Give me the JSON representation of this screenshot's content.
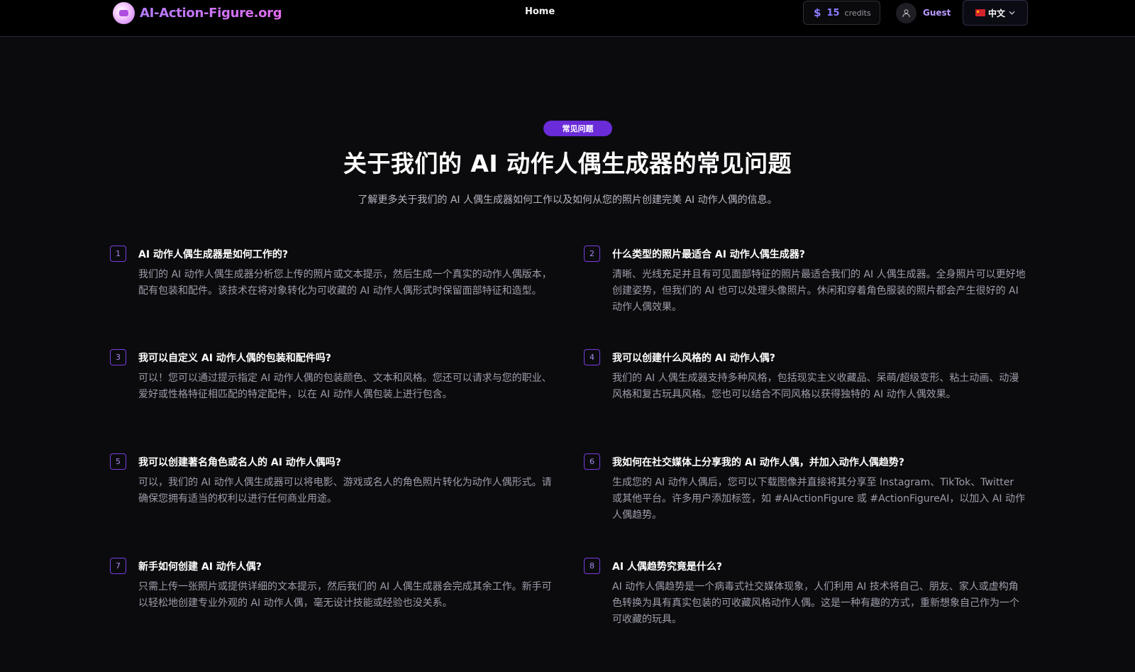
{
  "header": {
    "logo_text": "AI-Action-Figure.org",
    "nav_home": "Home",
    "credits_symbol": "$",
    "credits_count": "15",
    "credits_label": "credits",
    "user_name": "Guest",
    "language": "中文"
  },
  "section": {
    "badge": "常见问题",
    "title": "关于我们的 AI 动作人偶生成器的常见问题",
    "subtitle": "了解更多关于我们的 AI 人偶生成器如何工作以及如何从您的照片创建完美 AI 动作人偶的信息。"
  },
  "faqs": [
    {
      "num": "1",
      "question": "AI 动作人偶生成器是如何工作的?",
      "answer": "我们的 AI 动作人偶生成器分析您上传的照片或文本提示，然后生成一个真实的动作人偶版本，配有包装和配件。该技术在将对象转化为可收藏的 AI 动作人偶形式时保留面部特征和造型。"
    },
    {
      "num": "2",
      "question": "什么类型的照片最适合 AI 动作人偶生成器?",
      "answer": "清晰、光线充足并且有可见面部特征的照片最适合我们的 AI 人偶生成器。全身照片可以更好地创建姿势，但我们的 AI 也可以处理头像照片。休闲和穿着角色服装的照片都会产生很好的 AI 动作人偶效果。"
    },
    {
      "num": "3",
      "question": "我可以自定义 AI 动作人偶的包装和配件吗?",
      "answer": "可以！您可以通过提示指定 AI 动作人偶的包装颜色、文本和风格。您还可以请求与您的职业、爱好或性格特征相匹配的特定配件，以在 AI 动作人偶包装上进行包含。"
    },
    {
      "num": "4",
      "question": "我可以创建什么风格的 AI 动作人偶?",
      "answer": "我们的 AI 人偶生成器支持多种风格，包括现实主义收藏品、呆萌/超级变形、粘土动画、动漫风格和复古玩具风格。您也可以结合不同风格以获得独特的 AI 动作人偶效果。"
    },
    {
      "num": "5",
      "question": "我可以创建著名角色或名人的 AI 动作人偶吗?",
      "answer": "可以，我们的 AI 动作人偶生成器可以将电影、游戏或名人的角色照片转化为动作人偶形式。请确保您拥有适当的权利以进行任何商业用途。"
    },
    {
      "num": "6",
      "question": "我如何在社交媒体上分享我的 AI 动作人偶，并加入动作人偶趋势?",
      "answer": "生成您的 AI 动作人偶后，您可以下载图像并直接将其分享至 Instagram、TikTok、Twitter 或其他平台。许多用户添加标签，如 #AIActionFigure 或 #ActionFigureAI，以加入 AI 动作人偶趋势。"
    },
    {
      "num": "7",
      "question": "新手如何创建 AI 动作人偶?",
      "answer": "只需上传一张照片或提供详细的文本提示，然后我们的 AI 人偶生成器会完成其余工作。新手可以轻松地创建专业外观的 AI 动作人偶，毫无设计技能或经验也没关系。"
    },
    {
      "num": "8",
      "question": "AI 人偶趋势究竟是什么?",
      "answer": "AI 动作人偶趋势是一个病毒式社交媒体现象，人们利用 AI 技术将自己、朋友、家人或虚构角色转换为具有真实包装的可收藏风格动作人偶。这是一种有趣的方式，重新想象自己作为一个可收藏的玩具。"
    }
  ],
  "colors": {
    "background": "#0b0b0d",
    "accent": "#6a2bd9",
    "number_border": "#7a3ce0",
    "answer_text": "#9d9dab"
  }
}
